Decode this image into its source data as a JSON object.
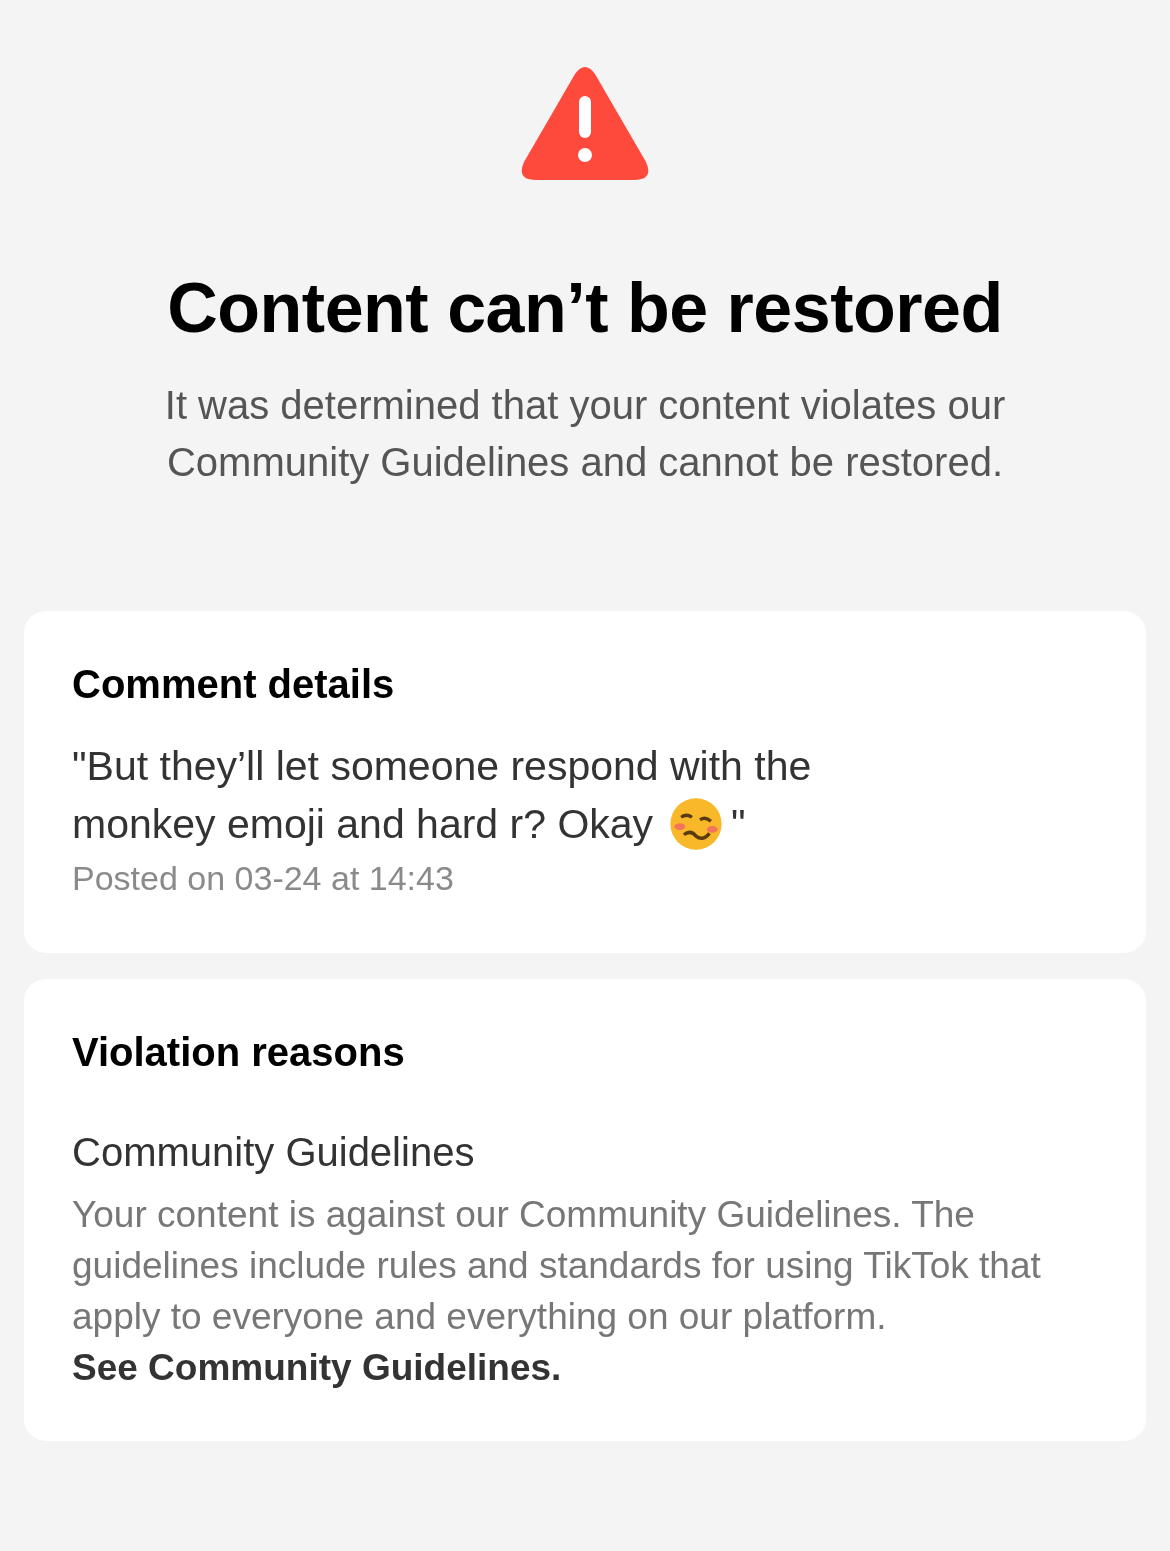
{
  "header": {
    "title": "Content can’t be restored",
    "message": "It was determined that your content violates our Community Guidelines and cannot be restored."
  },
  "comment_card": {
    "heading": "Comment details",
    "comment_lines": [
      "\"But they’ll let someone respond with the",
      "monkey emoji and hard r? Okay"
    ],
    "closing_quote": "\"",
    "posted": "Posted on 03-24 at 14:43"
  },
  "violation_card": {
    "heading": "Violation reasons",
    "reason_title": "Community Guidelines",
    "reason_text": "Your content is against our Community Guidelines. The guidelines include rules and standards for using TikTok that apply to everyone and everything on our platform.",
    "link": "See Community Guidelines."
  }
}
